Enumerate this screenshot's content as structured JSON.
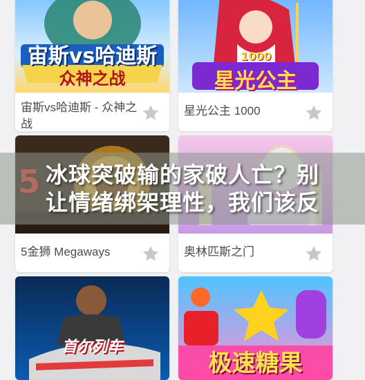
{
  "banner": {
    "title": "冰球突破输的家破人亡？别让情绪绑架理性，我们该反"
  },
  "games": [
    {
      "title": "宙斯vs哈迪斯 - 众神之战",
      "art_text": "宙斯vs哈迪斯",
      "art_subtext": "众神之战",
      "favorite_icon": "star-icon",
      "accent": "#2a8fd8"
    },
    {
      "title": "星光公主 1000",
      "art_text": "星光公主",
      "art_subtext": "1000",
      "favorite_icon": "star-icon",
      "accent": "#e0457b"
    },
    {
      "title": "5金狮 Megaways",
      "art_text": "5",
      "art_subtext": "",
      "favorite_icon": "star-icon",
      "accent": "#c0302a"
    },
    {
      "title": "奥林匹斯之门",
      "art_text": "",
      "art_subtext": "",
      "favorite_icon": "star-icon",
      "accent": "#9c6bd6"
    },
    {
      "title": "",
      "art_text": "首尔列车",
      "art_subtext": "",
      "favorite_icon": "",
      "accent": "#1d6cc9"
    },
    {
      "title": "",
      "art_text": "极速糖果",
      "art_subtext": "",
      "favorite_icon": "",
      "accent": "#ff4fa0"
    }
  ],
  "colors": {
    "background": "#f1f1f3",
    "card": "#ffffff",
    "star": "#c8c8cc",
    "title_text": "#4b4b4b"
  }
}
